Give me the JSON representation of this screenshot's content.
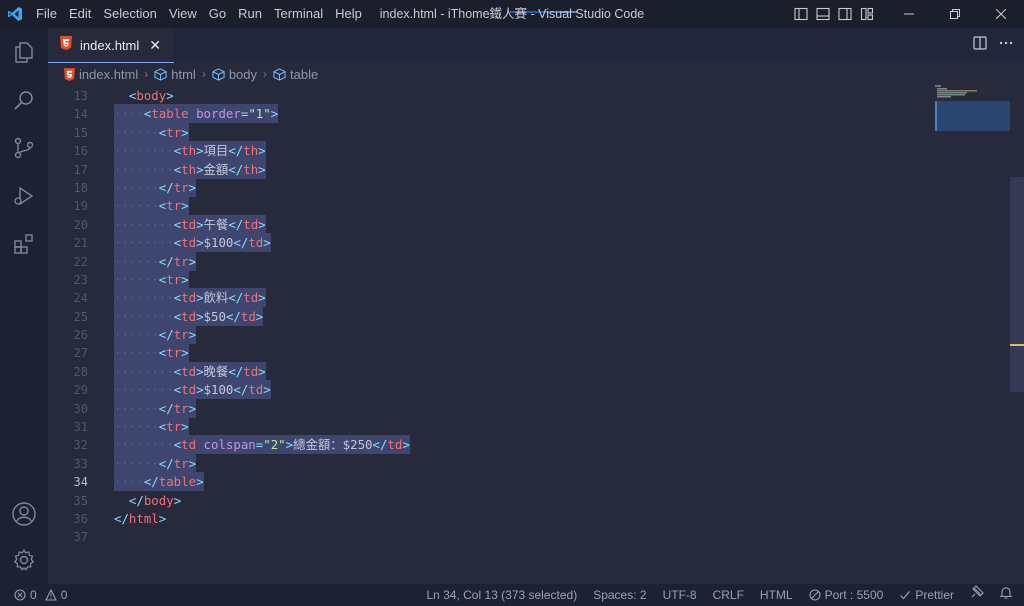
{
  "menu": [
    "File",
    "Edit",
    "Selection",
    "View",
    "Go",
    "Run",
    "Terminal",
    "Help"
  ],
  "window_title": "index.html - iThome鐵人賽 - Visual Studio Code",
  "tab": {
    "label": "index.html",
    "close": "✕"
  },
  "breadcrumb": [
    "index.html",
    "html",
    "body",
    "table"
  ],
  "editor": {
    "active_line": 34,
    "lines": [
      {
        "no": "13",
        "indent": "  ",
        "sel": false,
        "tokens": [
          [
            "b",
            "<"
          ],
          [
            "n",
            "body"
          ],
          [
            "b",
            ">"
          ]
        ]
      },
      {
        "no": "14",
        "indent": "····",
        "sel": true,
        "tokens": [
          [
            "b",
            "<"
          ],
          [
            "n",
            "table"
          ],
          [
            "t",
            " "
          ],
          [
            "a",
            "border"
          ],
          [
            "b",
            "="
          ],
          [
            "s",
            "\"1\""
          ],
          [
            "b",
            ">"
          ]
        ]
      },
      {
        "no": "15",
        "indent": "······",
        "sel": true,
        "tokens": [
          [
            "b",
            "<"
          ],
          [
            "n",
            "tr"
          ],
          [
            "b",
            ">"
          ]
        ]
      },
      {
        "no": "16",
        "indent": "········",
        "sel": true,
        "tokens": [
          [
            "b",
            "<"
          ],
          [
            "n",
            "th"
          ],
          [
            "b",
            ">"
          ],
          [
            "t",
            "項目"
          ],
          [
            "b",
            "</"
          ],
          [
            "n",
            "th"
          ],
          [
            "b",
            ">"
          ]
        ]
      },
      {
        "no": "17",
        "indent": "········",
        "sel": true,
        "tokens": [
          [
            "b",
            "<"
          ],
          [
            "n",
            "th"
          ],
          [
            "b",
            ">"
          ],
          [
            "t",
            "金額"
          ],
          [
            "b",
            "</"
          ],
          [
            "n",
            "th"
          ],
          [
            "b",
            ">"
          ]
        ]
      },
      {
        "no": "18",
        "indent": "······",
        "sel": true,
        "tokens": [
          [
            "b",
            "</"
          ],
          [
            "n",
            "tr"
          ],
          [
            "b",
            ">"
          ]
        ]
      },
      {
        "no": "19",
        "indent": "······",
        "sel": true,
        "tokens": [
          [
            "b",
            "<"
          ],
          [
            "n",
            "tr"
          ],
          [
            "b",
            ">"
          ]
        ]
      },
      {
        "no": "20",
        "indent": "········",
        "sel": true,
        "tokens": [
          [
            "b",
            "<"
          ],
          [
            "n",
            "td"
          ],
          [
            "b",
            ">"
          ],
          [
            "t",
            "午餐"
          ],
          [
            "b",
            "</"
          ],
          [
            "n",
            "td"
          ],
          [
            "b",
            ">"
          ]
        ]
      },
      {
        "no": "21",
        "indent": "········",
        "sel": true,
        "tokens": [
          [
            "b",
            "<"
          ],
          [
            "n",
            "td"
          ],
          [
            "b",
            ">"
          ],
          [
            "t",
            "$100"
          ],
          [
            "b",
            "</"
          ],
          [
            "n",
            "td"
          ],
          [
            "b",
            ">"
          ]
        ]
      },
      {
        "no": "22",
        "indent": "······",
        "sel": true,
        "tokens": [
          [
            "b",
            "</"
          ],
          [
            "n",
            "tr"
          ],
          [
            "b",
            ">"
          ]
        ]
      },
      {
        "no": "23",
        "indent": "······",
        "sel": true,
        "tokens": [
          [
            "b",
            "<"
          ],
          [
            "n",
            "tr"
          ],
          [
            "b",
            ">"
          ]
        ]
      },
      {
        "no": "24",
        "indent": "········",
        "sel": true,
        "tokens": [
          [
            "b",
            "<"
          ],
          [
            "n",
            "td"
          ],
          [
            "b",
            ">"
          ],
          [
            "t",
            "飲料"
          ],
          [
            "b",
            "</"
          ],
          [
            "n",
            "td"
          ],
          [
            "b",
            ">"
          ]
        ]
      },
      {
        "no": "25",
        "indent": "········",
        "sel": true,
        "tokens": [
          [
            "b",
            "<"
          ],
          [
            "n",
            "td"
          ],
          [
            "b",
            ">"
          ],
          [
            "t",
            "$50"
          ],
          [
            "b",
            "</"
          ],
          [
            "n",
            "td"
          ],
          [
            "b",
            ">"
          ]
        ]
      },
      {
        "no": "26",
        "indent": "······",
        "sel": true,
        "tokens": [
          [
            "b",
            "</"
          ],
          [
            "n",
            "tr"
          ],
          [
            "b",
            ">"
          ]
        ]
      },
      {
        "no": "27",
        "indent": "······",
        "sel": true,
        "tokens": [
          [
            "b",
            "<"
          ],
          [
            "n",
            "tr"
          ],
          [
            "b",
            ">"
          ]
        ]
      },
      {
        "no": "28",
        "indent": "········",
        "sel": true,
        "tokens": [
          [
            "b",
            "<"
          ],
          [
            "n",
            "td"
          ],
          [
            "b",
            ">"
          ],
          [
            "t",
            "晚餐"
          ],
          [
            "b",
            "</"
          ],
          [
            "n",
            "td"
          ],
          [
            "b",
            ">"
          ]
        ]
      },
      {
        "no": "29",
        "indent": "········",
        "sel": true,
        "tokens": [
          [
            "b",
            "<"
          ],
          [
            "n",
            "td"
          ],
          [
            "b",
            ">"
          ],
          [
            "t",
            "$100"
          ],
          [
            "b",
            "</"
          ],
          [
            "n",
            "td"
          ],
          [
            "b",
            ">"
          ]
        ]
      },
      {
        "no": "30",
        "indent": "······",
        "sel": true,
        "tokens": [
          [
            "b",
            "</"
          ],
          [
            "n",
            "tr"
          ],
          [
            "b",
            ">"
          ]
        ]
      },
      {
        "no": "31",
        "indent": "······",
        "sel": true,
        "tokens": [
          [
            "b",
            "<"
          ],
          [
            "n",
            "tr"
          ],
          [
            "b",
            ">"
          ]
        ]
      },
      {
        "no": "32",
        "indent": "········",
        "sel": true,
        "tokens": [
          [
            "b",
            "<"
          ],
          [
            "n",
            "td"
          ],
          [
            "t",
            " "
          ],
          [
            "a",
            "colspan"
          ],
          [
            "b",
            "="
          ],
          [
            "s",
            "\"2\""
          ],
          [
            "b",
            ">"
          ],
          [
            "t",
            "總金額：$250"
          ],
          [
            "b",
            "</"
          ],
          [
            "n",
            "td"
          ],
          [
            "b",
            ">"
          ]
        ]
      },
      {
        "no": "33",
        "indent": "······",
        "sel": true,
        "tokens": [
          [
            "b",
            "</"
          ],
          [
            "n",
            "tr"
          ],
          [
            "b",
            ">"
          ]
        ]
      },
      {
        "no": "34",
        "indent": "····",
        "sel": true,
        "tokens": [
          [
            "b",
            "</"
          ],
          [
            "n",
            "table"
          ],
          [
            "b",
            ">"
          ]
        ]
      },
      {
        "no": "35",
        "indent": "  ",
        "sel": false,
        "tokens": [
          [
            "b",
            "</"
          ],
          [
            "n",
            "body"
          ],
          [
            "b",
            ">"
          ]
        ]
      },
      {
        "no": "36",
        "indent": "",
        "sel": false,
        "tokens": [
          [
            "b",
            "</"
          ],
          [
            "n",
            "html"
          ],
          [
            "b",
            ">"
          ]
        ]
      },
      {
        "no": "37",
        "indent": "",
        "sel": false,
        "tokens": []
      }
    ]
  },
  "status": {
    "errors": "0",
    "warnings": "0",
    "position": "Ln 34, Col 13 (373 selected)",
    "spaces": "Spaces: 2",
    "encoding": "UTF-8",
    "eol": "CRLF",
    "language": "HTML",
    "port": "Port : 5500",
    "prettier": "Prettier"
  },
  "colors": {
    "background": "#262a3b",
    "titlebar": "#1b1e2b",
    "selection": "#3e4670",
    "tag_bracket": "#89ddff",
    "tag_name": "#f07178",
    "attribute": "#c792ea",
    "string": "#c3e88d"
  }
}
